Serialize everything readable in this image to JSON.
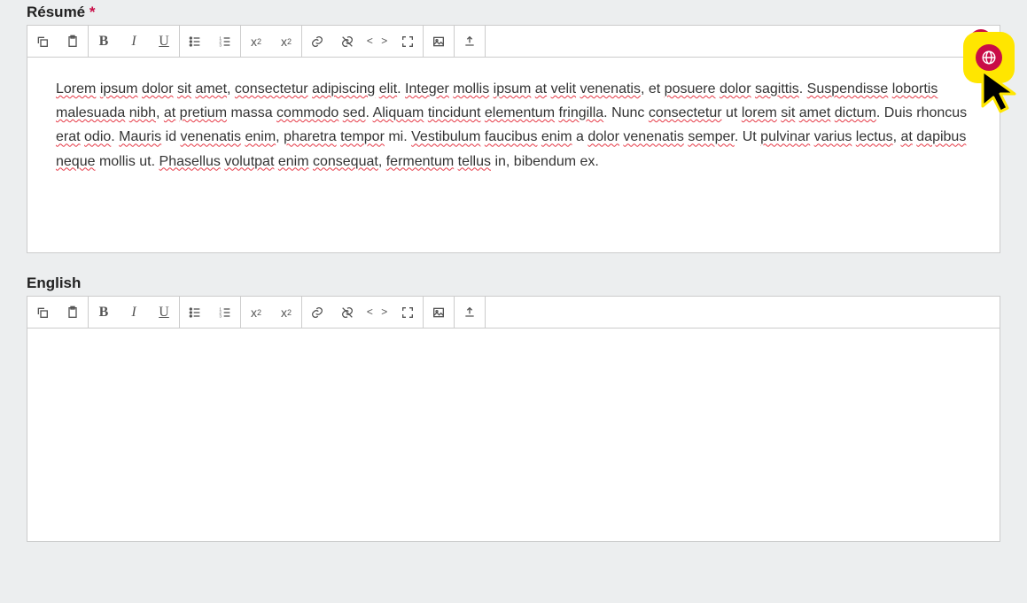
{
  "section1": {
    "label": "Résumé",
    "required_mark": "*",
    "content_html": "<span class='sp'>Lorem</span> <span class='sp'>ipsum</span> <span class='sp'>dolor</span> <span class='sp'>sit</span> <span class='sp'>amet</span>, <span class='sp'>consectetur</span> <span class='sp'>adipiscing</span> <span class='sp'>elit</span>. <span class='sp'>Integer</span> <span class='sp'>mollis</span> <span class='sp'>ipsum</span> <span class='sp'>at</span> <span class='sp'>velit</span> <span class='sp'>venenatis</span>, et <span class='sp'>posuere</span> <span class='sp'>dolor</span> <span class='sp'>sagittis</span>. <span class='sp'>Suspendisse</span> <span class='sp'>lobortis</span> <span class='sp'>malesuada</span> <span class='sp'>nibh</span>, <span class='sp'>at</span> <span class='sp'>pretium</span> massa <span class='sp'>commodo</span> <span class='sp'>sed</span>. <span class='sp'>Aliquam</span> <span class='sp'>tincidunt</span> <span class='sp'>elementum</span> <span class='sp'>fringilla</span>. Nunc <span class='sp'>consectetur</span> ut <span class='sp'>lorem</span> <span class='sp'>sit</span> <span class='sp'>amet</span> <span class='sp'>dictum</span>. Duis rhoncus <span class='sp'>erat</span> <span class='sp'>odio</span>. <span class='sp'>Mauris</span> id <span class='sp'>venenatis</span> <span class='sp'>enim</span>, <span class='sp'>pharetra</span> <span class='sp'>tempor</span> mi. <span class='sp'>Vestibulum</span> <span class='sp'>faucibus</span> <span class='sp'>enim</span> a <span class='sp'>dolor</span> <span class='sp'>venenatis</span> <span class='sp'>semper</span>. Ut <span class='sp'>pulvinar</span> <span class='sp'>varius</span> <span class='sp'>lectus</span>, <span class='sp'>at</span> <span class='sp'>dapibus</span> <span class='sp'>neque</span> mollis ut. <span class='sp'>Phasellus</span> <span class='sp'>volutpat</span> <span class='sp'>enim</span> <span class='sp'>consequat</span>, <span class='sp'>fermentum</span> <span class='sp'>tellus</span> in, bibendum ex."
  },
  "section2": {
    "label": "English",
    "content_html": ""
  },
  "toolbar_icons": {
    "copy": "copy-icon",
    "paste": "paste-icon",
    "bold": "B",
    "italic": "I",
    "underline": "U",
    "ul": "bullet-list-icon",
    "ol": "number-list-icon",
    "sup": "x²",
    "sub": "x₂",
    "link": "link-icon",
    "unlink": "unlink-icon",
    "code": "< >",
    "fullscreen": "fullscreen-icon",
    "image": "image-icon",
    "upload": "upload-icon",
    "globe": "globe-icon"
  }
}
